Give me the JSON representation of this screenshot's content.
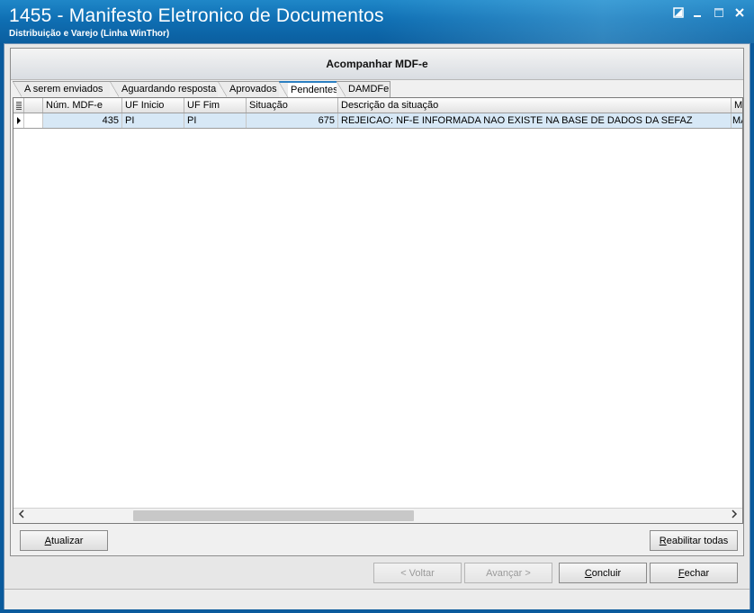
{
  "window": {
    "title": "1455 - Manifesto Eletronico de Documentos",
    "subtitle": "Distribuição e Varejo (Linha WinThor)"
  },
  "panel": {
    "header": "Acompanhar MDF-e"
  },
  "tabs": [
    {
      "label": "A serem enviados",
      "active": false
    },
    {
      "label": "Aguardando resposta",
      "active": false
    },
    {
      "label": "Aprovados",
      "active": false
    },
    {
      "label": "Pendentes",
      "active": true
    },
    {
      "label": "DAMDFe",
      "active": false
    }
  ],
  "grid": {
    "columns": [
      "Núm. MDF-e",
      "UF Inicio",
      "UF Fim",
      "Situação",
      "Descrição da situação",
      "Mo"
    ],
    "rows": [
      {
        "num": "435",
        "uf_inicio": "PI",
        "uf_fim": "PI",
        "situacao": "675",
        "descricao": "REJEICAO: NF-E INFORMADA NAO EXISTE NA BASE DE DADOS DA SEFAZ",
        "mo": "MA"
      }
    ]
  },
  "buttons": {
    "atualizar": {
      "first": "A",
      "rest": "tualizar"
    },
    "reabilitar": {
      "first": "R",
      "rest": "eabilitar todas"
    },
    "voltar": "< Voltar",
    "avancar": "Avançar >",
    "concluir": {
      "first": "C",
      "rest": "oncluir"
    },
    "fechar": {
      "first": "F",
      "rest": "echar"
    }
  },
  "icons": {
    "grid_menu": "grid-menu-icon",
    "row_pointer": "row-pointer-icon",
    "scroll_left": "chevron-left-icon",
    "scroll_right": "chevron-right-icon"
  },
  "colors": {
    "title_bar": "#0f6fb3",
    "selected_row": "#d7e8f6",
    "active_tab": "#2b7fc1"
  }
}
